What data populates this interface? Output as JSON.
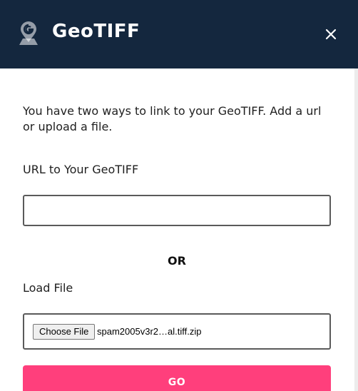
{
  "header": {
    "title": "GeoTIFF",
    "logo_icon": "map-pin-g-icon",
    "close_icon": "close-icon",
    "background_color": "#14273e"
  },
  "intro": {
    "text": "You have two ways to link to your GeoTIFF. Add a url or upload a file."
  },
  "url_field": {
    "label": "URL to Your GeoTIFF",
    "value": "",
    "placeholder": ""
  },
  "divider": {
    "text": "OR"
  },
  "file_field": {
    "label": "Load File",
    "button_label": "Choose File",
    "selected_file": "spam2005v3r2…al.tiff.zip"
  },
  "submit": {
    "label": "GO",
    "color": "#ff3f7c"
  }
}
